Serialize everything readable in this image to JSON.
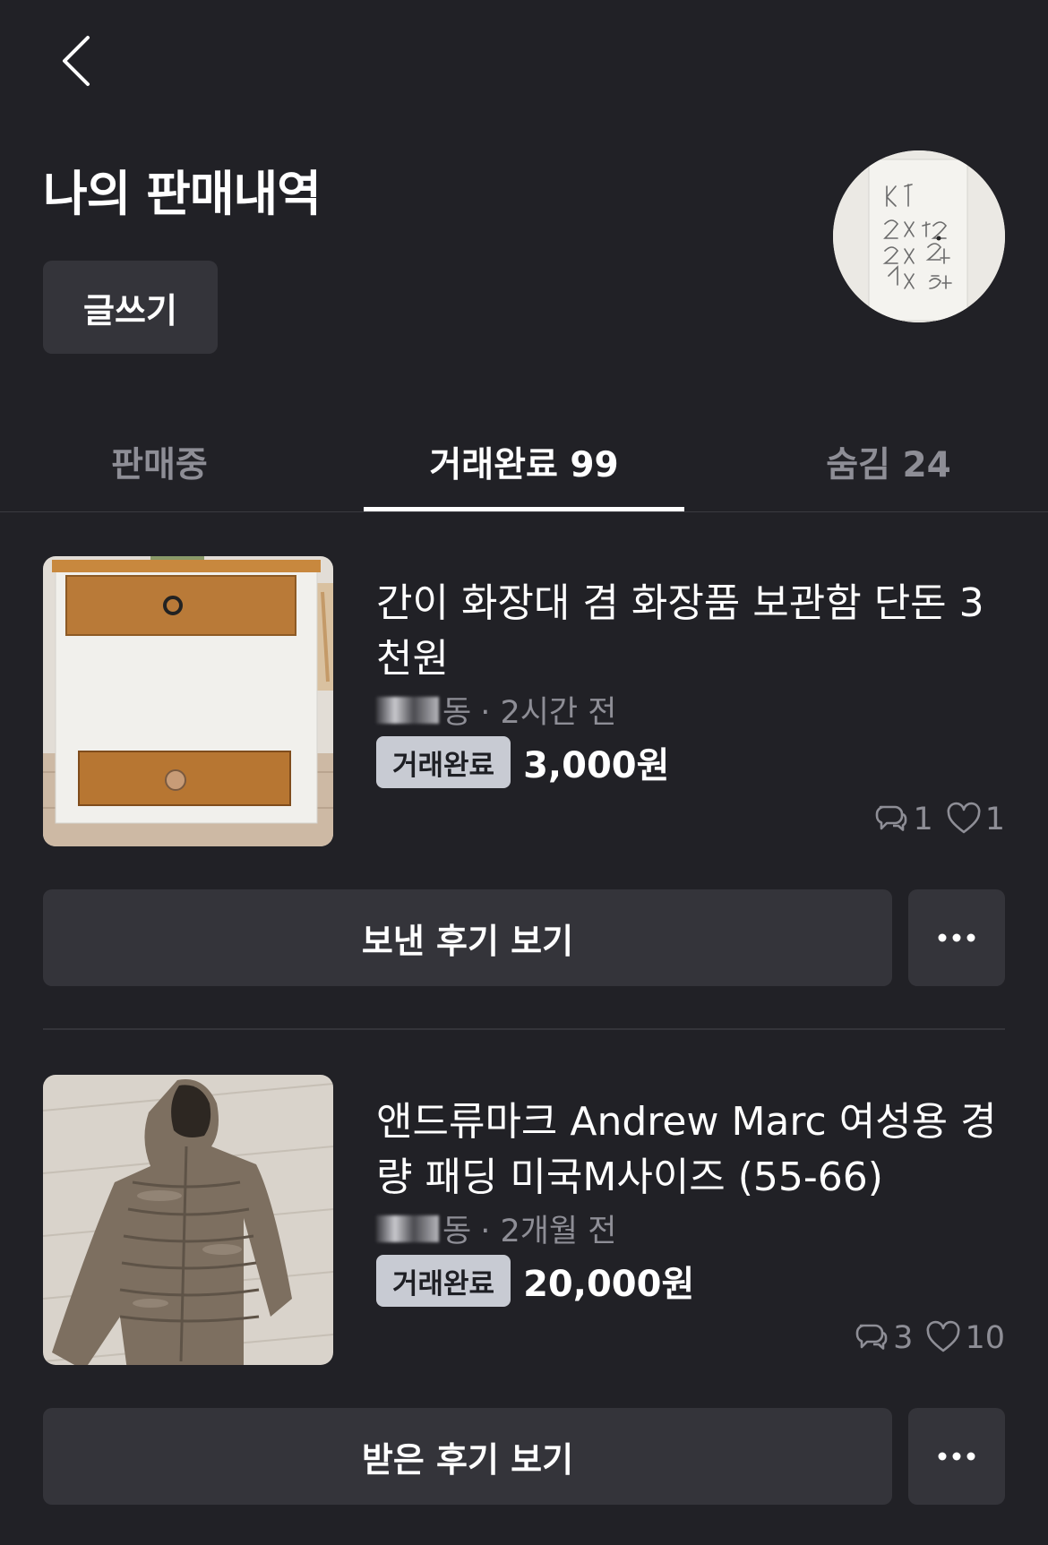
{
  "header": {
    "back_icon": "chevron-left-icon",
    "title": "나의 판매내역",
    "write_label": "글쓰기"
  },
  "tabs": [
    {
      "label": "판매중",
      "active": false
    },
    {
      "label": "거래완료 99",
      "active": true
    },
    {
      "label": "숨김 24",
      "active": false
    }
  ],
  "items": [
    {
      "title": "간이 화장대 겸 화장품 보관함 단돈 3천원",
      "location_suffix": "동",
      "time": "· 2시간 전",
      "status": "거래완료",
      "price": "3,000원",
      "comments": "1",
      "likes": "1",
      "review_label": "보낸 후기 보기"
    },
    {
      "title": "앤드류마크 Andrew Marc 여성용 경량 패딩 미국M사이즈 (55-66)",
      "location_suffix": "동",
      "time": "· 2개월 전",
      "status": "거래완료",
      "price": "20,000원",
      "comments": "3",
      "likes": "10",
      "review_label": "받은 후기 보기"
    }
  ],
  "colors": {
    "background": "#212126",
    "surface": "#34343a",
    "muted_text": "#8e8e96",
    "badge_bg": "#c8cbd3"
  }
}
